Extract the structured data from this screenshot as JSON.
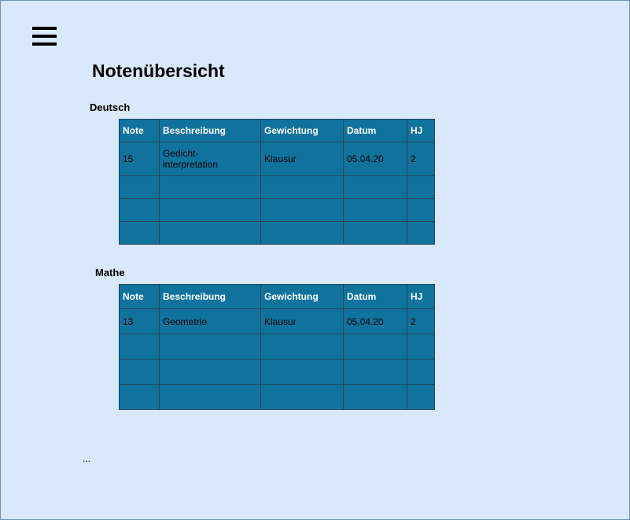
{
  "page": {
    "title": "Notenübersicht",
    "ellipsis": "..."
  },
  "menu": {
    "icon": "hamburger-menu-icon"
  },
  "columns": [
    "Note",
    "Beschreibung",
    "Gewichtung",
    "Datum",
    "HJ"
  ],
  "subjects": [
    {
      "name": "Deutsch",
      "rows": [
        [
          "15",
          "Gedicht-interpretation",
          "Klausur",
          "05.04.20",
          "2"
        ],
        [
          "",
          "",
          "",
          "",
          ""
        ],
        [
          "",
          "",
          "",
          "",
          ""
        ],
        [
          "",
          "",
          "",
          "",
          ""
        ]
      ]
    },
    {
      "name": "Mathe",
      "rows": [
        [
          "13",
          "Geometrie",
          "Klausur",
          "05.04.20",
          "2"
        ],
        [
          "",
          "",
          "",
          "",
          ""
        ],
        [
          "",
          "",
          "",
          "",
          ""
        ],
        [
          "",
          "",
          "",
          "",
          ""
        ]
      ]
    }
  ],
  "colors": {
    "background": "#dae8fc",
    "table_fill": "#10739e",
    "table_border": "#23445d"
  }
}
